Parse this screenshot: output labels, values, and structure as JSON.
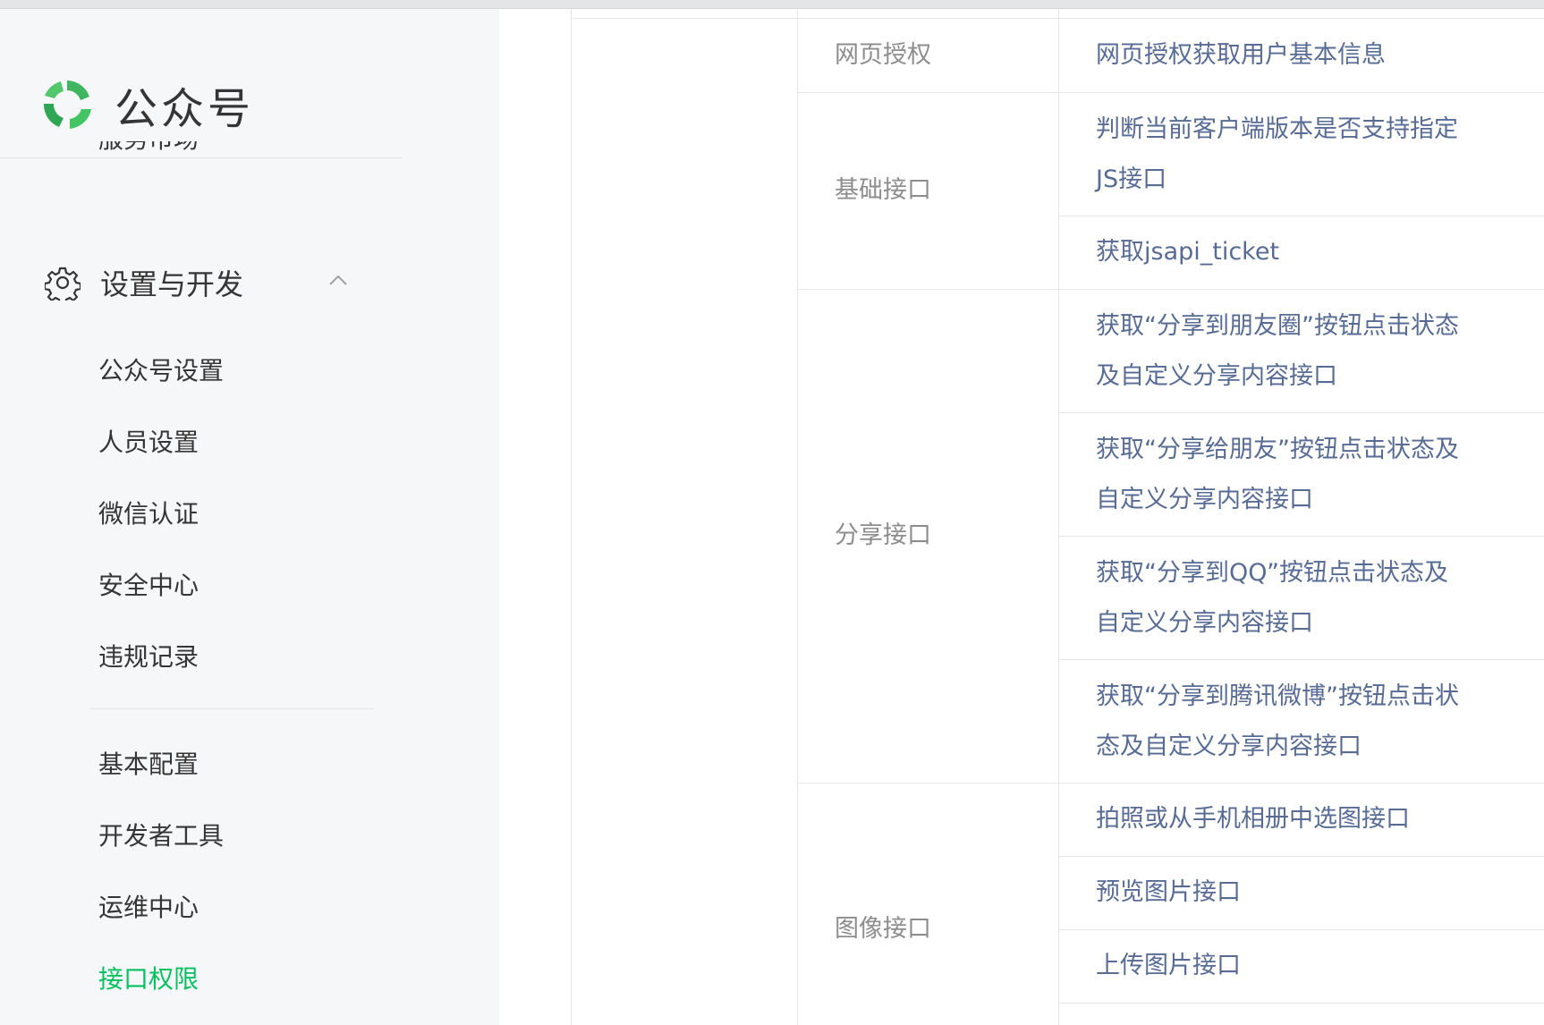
{
  "sidebar": {
    "logo_text": "公众号",
    "cut_item": "服务市场",
    "group_title": "设置与开发",
    "items_a": [
      "公众号设置",
      "人员设置",
      "微信认证",
      "安全中心",
      "违规记录"
    ],
    "items_b": [
      "基本配置",
      "开发者工具",
      "运维中心",
      "接口权限"
    ],
    "active_item": "接口权限"
  },
  "table": {
    "rows": [
      {
        "category": "网页授权",
        "apis": [
          "网页授权获取用户基本信息"
        ]
      },
      {
        "category": "基础接口",
        "apis": [
          "判断当前客户端版本是否支持指定JS接口",
          "获取jsapi_ticket"
        ]
      },
      {
        "category": "分享接口",
        "apis": [
          "获取“分享到朋友圈”按钮点击状态及自定义分享内容接口",
          "获取“分享给朋友”按钮点击状态及自定义分享内容接口",
          "获取“分享到QQ”按钮点击状态及自定义分享内容接口",
          "获取“分享到腾讯微博”按钮点击状态及自定义分享内容接口"
        ]
      },
      {
        "category": "图像接口",
        "apis": [
          "拍照或从手机相册中选图接口",
          "预览图片接口",
          "上传图片接口"
        ]
      }
    ]
  },
  "colors": {
    "accent_green": "#07c160",
    "link_blue": "#576b95",
    "category_gray": "#8d8d8d",
    "sidebar_bg": "#f6f7f9"
  },
  "icons": [
    "wechat-mp-logo-icon",
    "gear-icon",
    "chevron-up-icon"
  ]
}
